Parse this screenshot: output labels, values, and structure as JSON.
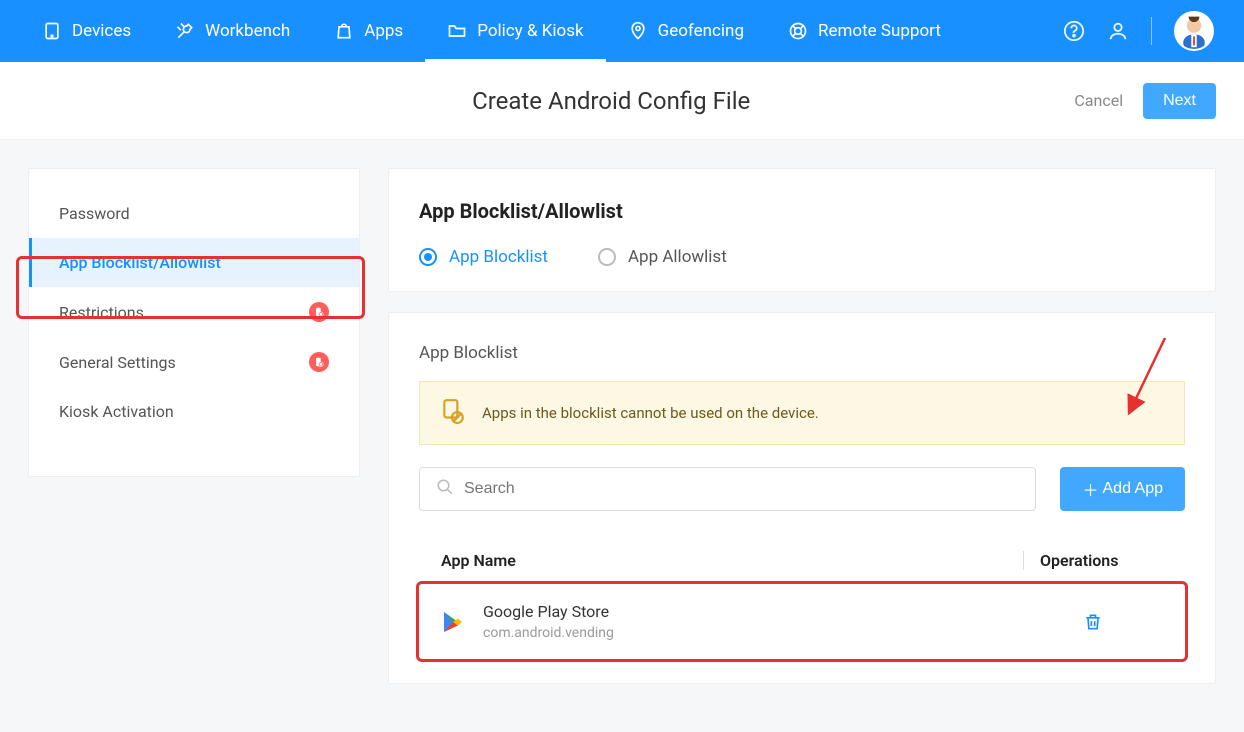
{
  "nav": {
    "items": [
      {
        "label": "Devices"
      },
      {
        "label": "Workbench"
      },
      {
        "label": "Apps"
      },
      {
        "label": "Policy & Kiosk"
      },
      {
        "label": "Geofencing"
      },
      {
        "label": "Remote Support"
      }
    ]
  },
  "header": {
    "title": "Create Android Config File",
    "cancel": "Cancel",
    "next": "Next"
  },
  "sidebar": {
    "items": [
      {
        "label": "Password"
      },
      {
        "label": "App Blocklist/Allowlist"
      },
      {
        "label": "Restrictions"
      },
      {
        "label": "General Settings"
      },
      {
        "label": "Kiosk Activation"
      }
    ]
  },
  "panel": {
    "title": "App Blocklist/Allowlist",
    "radio_blocklist": "App Blocklist",
    "radio_allowlist": "App Allowlist"
  },
  "blocklist": {
    "section_title": "App Blocklist",
    "info": "Apps in the blocklist cannot be used on the device.",
    "search_placeholder": "Search",
    "add_button": "Add App",
    "col_name": "App Name",
    "col_ops": "Operations",
    "rows": [
      {
        "name": "Google Play Store",
        "pkg": "com.android.vending"
      }
    ]
  }
}
